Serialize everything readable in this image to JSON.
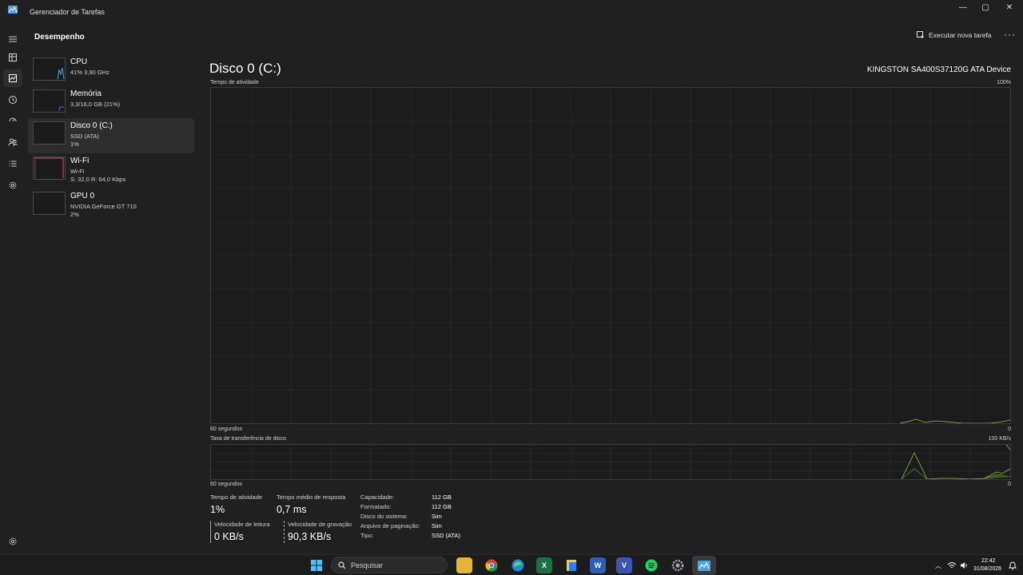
{
  "window": {
    "title": "Gerenciador de Tarefas",
    "controls": {
      "minimize": "—",
      "maximize": "▢",
      "close": "✕"
    }
  },
  "header": {
    "title": "Desempenho",
    "new_task_label": "Executar nova tarefa",
    "more_label": "···"
  },
  "rail_icons": [
    "menu-icon",
    "processes-icon",
    "performance-icon",
    "history-icon",
    "startup-icon",
    "users-icon",
    "details-icon",
    "services-icon",
    "settings-icon"
  ],
  "devices": [
    {
      "name": "CPU",
      "sub1": "41% 3,90 GHz",
      "sub2": "",
      "color": "#4fa3e0"
    },
    {
      "name": "Memória",
      "sub1": "3,3/16,0 GB (21%)",
      "sub2": "",
      "color": "#4f6fe0"
    },
    {
      "name": "Disco 0 (C:)",
      "sub1": "SSD (ATA)",
      "sub2": "1%",
      "color": "#8cc63f"
    },
    {
      "name": "Wi-Fi",
      "sub1": "Wi-Fi",
      "sub2": "S: 32,0 R: 64,0 Kbps",
      "color": "#c2457d"
    },
    {
      "name": "GPU 0",
      "sub1": "NVIDIA GeForce GT 710",
      "sub2": "2%",
      "color": "#8a8a8a"
    }
  ],
  "main": {
    "title": "Disco 0 (C:)",
    "model": "KINGSTON SA400S37120G ATA Device",
    "activity_graph": {
      "label": "Tempo de atividade",
      "max_label": "100%",
      "time_label": "60 segundos",
      "min_label": "0"
    },
    "transfer_graph": {
      "label": "Taxa de transferência de disco",
      "max_label": "100 KB/s",
      "time_label": "60 segundos",
      "min_label": "0"
    },
    "stats": {
      "activity_label": "Tempo de atividade",
      "activity_value": "1%",
      "response_label": "Tempo médio de resposta",
      "response_value": "0,7 ms",
      "read_label": "Velocidade de leitura",
      "read_value": "0 KB/s",
      "write_label": "Velocidade de gravação",
      "write_value": "90,3 KB/s"
    },
    "info": [
      {
        "label": "Capacidade:",
        "value": "112 GB"
      },
      {
        "label": "Formatado:",
        "value": "112 GB"
      },
      {
        "label": "Disco do sistema:",
        "value": "Sim"
      },
      {
        "label": "Arquivo de paginação:",
        "value": "Sim"
      },
      {
        "label": "Tipo:",
        "value": "SSD (ATA)"
      }
    ]
  },
  "taskbar": {
    "search_placeholder": "Pesquisar",
    "apps": [
      "windows-start-icon",
      "file-explorer-icon",
      "chrome-icon",
      "edge-icon",
      "excel-icon",
      "notes-icon",
      "word-icon",
      "visio-icon",
      "spotify-icon",
      "settings-app-icon",
      "task-manager-icon"
    ],
    "time": "22:42",
    "date": "31/08/2026"
  },
  "colors": {
    "accent_green": "#8cc63f",
    "graph_bg": "#1c1c1c",
    "grid": "#2e2e2e"
  }
}
